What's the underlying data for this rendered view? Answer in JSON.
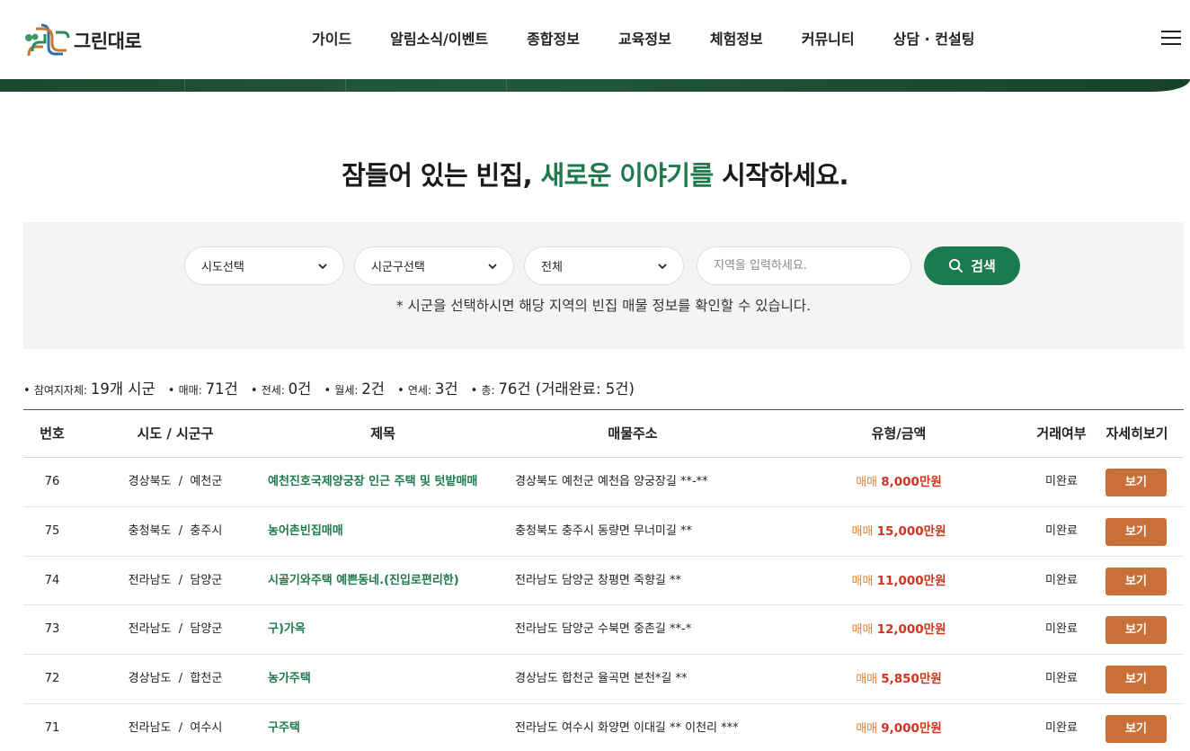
{
  "header": {
    "logo_text": "그린대로",
    "nav": [
      "가이드",
      "알림소식/이벤트",
      "종합정보",
      "교육정보",
      "체험정보",
      "커뮤니티",
      "상담 · 컨설팅"
    ],
    "menu_icon": "hamburger-icon"
  },
  "headline": {
    "part1": "잠들어 있는 빈집, ",
    "accent": "새로운 이야기를",
    "part2": " 시작하세요."
  },
  "search": {
    "sido_select": "시도선택",
    "sigungu_select": "시군구선택",
    "type_select": "전체",
    "input_placeholder": "지역을 입력하세요.",
    "input_value": "",
    "button_label": "검색",
    "note": "* 시군을 선택하시면 해당 지역의 빈집 매물 정보를 확인할 수 있습니다."
  },
  "stats": [
    {
      "label": "참여지자체: ",
      "value": "19개 시군"
    },
    {
      "label": "매매: ",
      "value": "71건"
    },
    {
      "label": "전세: ",
      "value": "0건"
    },
    {
      "label": "월세: ",
      "value": "2건"
    },
    {
      "label": "연세: ",
      "value": "3건"
    },
    {
      "label": "총: ",
      "value": "76건 (거래완료: 5건)"
    }
  ],
  "table": {
    "headers": [
      "번호",
      "시도 / 시군구",
      "제목",
      "매물주소",
      "유형/금액",
      "거래여부",
      "자세히보기"
    ],
    "view_label": "보기",
    "rows": [
      {
        "no": "76",
        "region": "경상북도  /  예천군",
        "title": "예천진호국제양궁장 인근 주택 및 텃밭매매",
        "address": "경상북도 예천군 예천읍 양궁장길 **-**",
        "type": "매매",
        "amount": "8,000만원",
        "status": "미완료"
      },
      {
        "no": "75",
        "region": "충청북도  /  충주시",
        "title": "농어촌빈집매매",
        "address": "충청북도 충주시 동량면 무너미길 **",
        "type": "매매",
        "amount": "15,000만원",
        "status": "미완료"
      },
      {
        "no": "74",
        "region": "전라남도  /  담양군",
        "title": "시골기와주택 예쁜동네.(진입로편리한)",
        "address": "전라남도 담양군 창평면 죽향길 **",
        "type": "매매",
        "amount": "11,000만원",
        "status": "미완료"
      },
      {
        "no": "73",
        "region": "전라남도  /  담양군",
        "title": "구)가옥",
        "address": "전라남도 담양군 수북면 중촌길 **-*",
        "type": "매매",
        "amount": "12,000만원",
        "status": "미완료"
      },
      {
        "no": "72",
        "region": "경상남도  /  합천군",
        "title": "농가주택",
        "address": "경상남도 합천군 율곡면 본천*길 **",
        "type": "매매",
        "amount": "5,850만원",
        "status": "미완료"
      },
      {
        "no": "71",
        "region": "전라남도  /  여수시",
        "title": "구주택",
        "address": "전라남도 여수시 화양면 이대길 ** 이천리 ***",
        "type": "매매",
        "amount": "9,000만원",
        "status": "미완료"
      }
    ]
  },
  "colors": {
    "brand_green": "#1b7a4e",
    "view_button": "#c87038",
    "price_red": "#d0341f",
    "type_orange": "#e0813a",
    "banner_dark_green": "#1d4d31"
  }
}
